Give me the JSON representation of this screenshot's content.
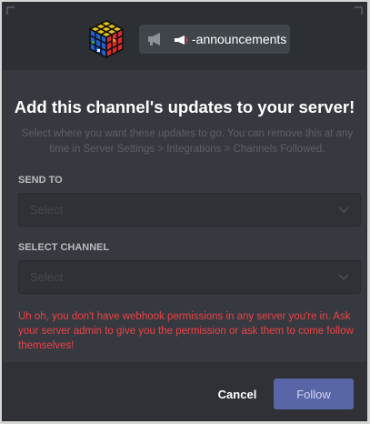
{
  "header": {
    "channel_name": "-announcements",
    "icons": [
      "rubiks-cube-icon",
      "megaphone-icon",
      "channel-name-icon"
    ]
  },
  "dialog": {
    "title": "Add this channel's updates to your server!",
    "subtitle": "Select where you want these updates to go. You can remove this at any time in Server Settings > Integrations > Channels Followed."
  },
  "send_to": {
    "label": "SEND TO",
    "placeholder": "Select"
  },
  "select_channel": {
    "label": "SELECT CHANNEL",
    "placeholder": "Select"
  },
  "error": {
    "message": "Uh oh, you don't have webhook permissions in any server you're in. Ask your server admin to give you the permission or ask them to come follow themselves!"
  },
  "footer": {
    "cancel_label": "Cancel",
    "follow_label": "Follow"
  },
  "colors": {
    "background": "#36393f",
    "header": "#2c2f33",
    "error": "#ed4245",
    "follow_button": "#5865a6"
  }
}
